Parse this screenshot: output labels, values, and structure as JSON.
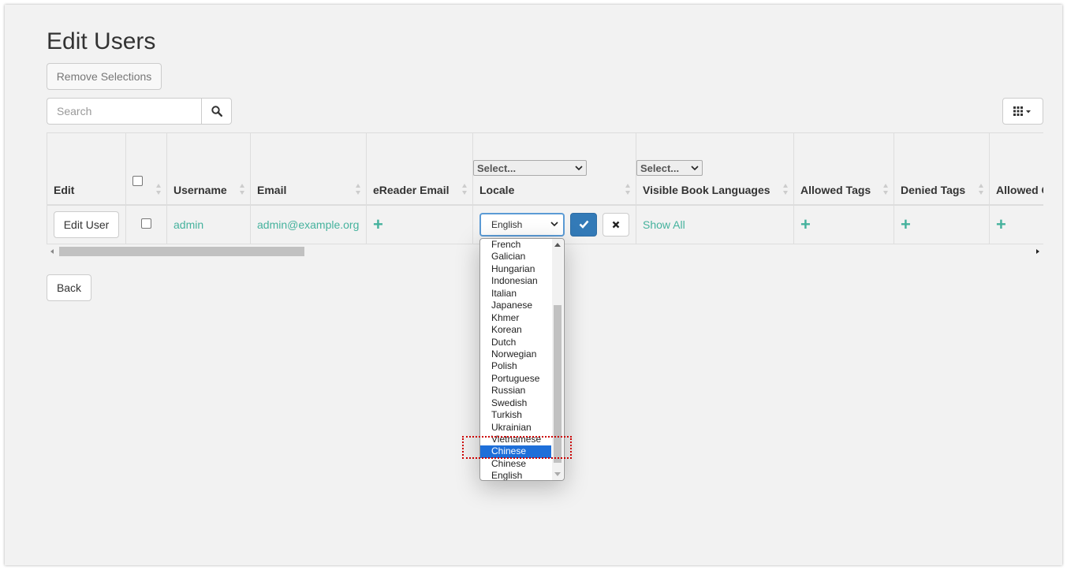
{
  "page": {
    "title": "Edit Users"
  },
  "toolbar": {
    "remove_label": "Remove Selections",
    "search_placeholder": "Search",
    "search_icon": "magnifier-icon",
    "columns_icon": "grid-columns-icon"
  },
  "table": {
    "headers": {
      "edit": "Edit",
      "username": "Username",
      "email": "Email",
      "ereader": "eReader Email",
      "locale": "Locale",
      "languages": "Visible Book Languages",
      "allowed_tags": "Allowed Tags",
      "denied_tags": "Denied Tags",
      "allowed_other": "Allowed C"
    },
    "filters": {
      "locale": "Select...",
      "languages": "Select..."
    },
    "row": {
      "edit_label": "Edit User",
      "username": "admin",
      "email": "admin@example.org",
      "locale_value": "English",
      "languages": "Show All",
      "plus": "+"
    }
  },
  "back_label": "Back",
  "locale_dropdown": {
    "options": [
      "French",
      "Galician",
      "Hungarian",
      "Indonesian",
      "Italian",
      "Japanese",
      "Khmer",
      "Korean",
      "Dutch",
      "Norwegian",
      "Polish",
      "Portuguese",
      "Russian",
      "Swedish",
      "Turkish",
      "Ukrainian",
      "Vietnamese",
      "Chinese",
      "Chinese",
      "English"
    ],
    "selected_index": 17
  },
  "colors": {
    "accent": "#45b29d",
    "primary": "#337ab7",
    "selection": "#1e6fd9"
  }
}
